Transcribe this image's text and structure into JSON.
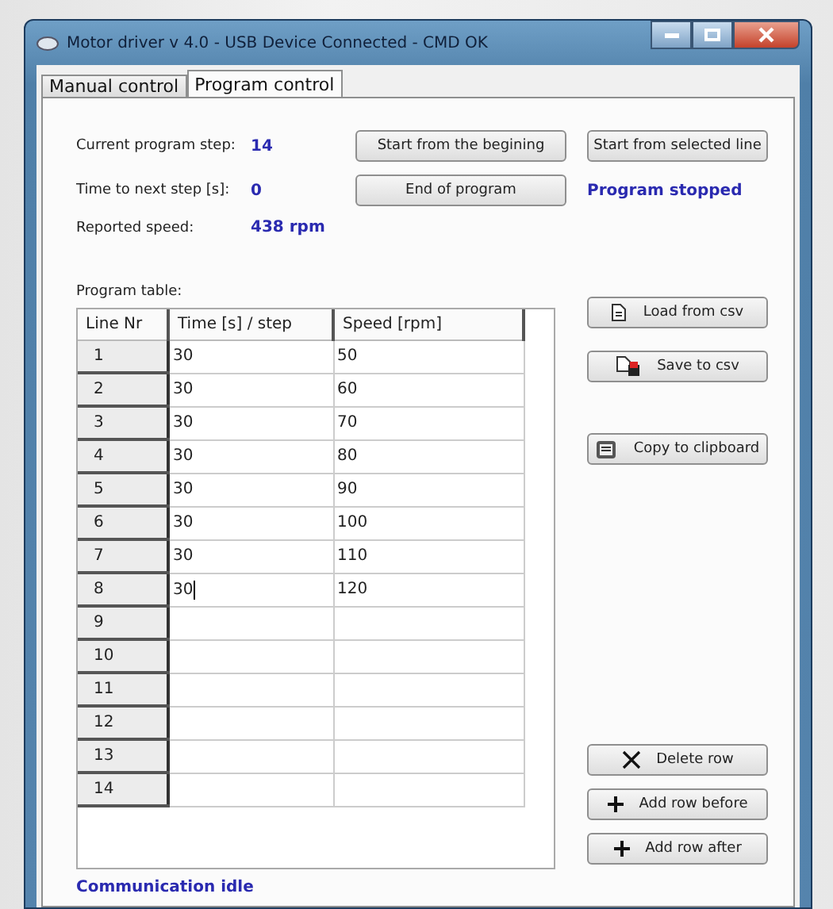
{
  "window": {
    "title": "Motor driver v 4.0 - USB Device Connected - CMD OK"
  },
  "tabs": [
    {
      "label": "Manual control",
      "selected": false
    },
    {
      "label": "Program control",
      "selected": true
    }
  ],
  "status": [
    {
      "label": "Current program step:",
      "value": "14"
    },
    {
      "label": "Time to next step [s]:",
      "value": "0"
    },
    {
      "label": "Reported speed:",
      "value": "438 rpm"
    }
  ],
  "program_buttons": [
    "Start from the begining",
    "End of program"
  ],
  "start_selected_button": "Start from selected line",
  "program_state": "Program stopped",
  "table": {
    "title": "Program table:",
    "columns": [
      "Line Nr",
      "Time [s] / step",
      "Speed [rpm]"
    ],
    "rows": [
      {
        "line": "1",
        "time": "30",
        "speed": "50",
        "editing": false
      },
      {
        "line": "2",
        "time": "30",
        "speed": "60",
        "editing": false
      },
      {
        "line": "3",
        "time": "30",
        "speed": "70",
        "editing": false
      },
      {
        "line": "4",
        "time": "30",
        "speed": "80",
        "editing": false
      },
      {
        "line": "5",
        "time": "30",
        "speed": "90",
        "editing": false
      },
      {
        "line": "6",
        "time": "30",
        "speed": "100",
        "editing": false
      },
      {
        "line": "7",
        "time": "30",
        "speed": "110",
        "editing": false
      },
      {
        "line": "8",
        "time": "30",
        "speed": "120",
        "editing": true
      },
      {
        "line": "9",
        "time": "",
        "speed": "",
        "editing": false
      },
      {
        "line": "10",
        "time": "",
        "speed": "",
        "editing": false
      },
      {
        "line": "11",
        "time": "",
        "speed": "",
        "editing": false
      },
      {
        "line": "12",
        "time": "",
        "speed": "",
        "editing": false
      },
      {
        "line": "13",
        "time": "",
        "speed": "",
        "editing": false
      },
      {
        "line": "14",
        "time": "",
        "speed": "",
        "editing": false
      }
    ]
  },
  "file_buttons": [
    {
      "label": "Load from csv",
      "kind": "load"
    },
    {
      "label": "Save to csv",
      "kind": "save"
    },
    {
      "label": "Copy to clipboard",
      "kind": "copy"
    }
  ],
  "row_buttons": [
    {
      "label": "Delete row",
      "kind": "delete"
    },
    {
      "label": "Add row before",
      "kind": "add"
    },
    {
      "label": "Add row after",
      "kind": "add"
    }
  ],
  "communication": "Communication idle"
}
